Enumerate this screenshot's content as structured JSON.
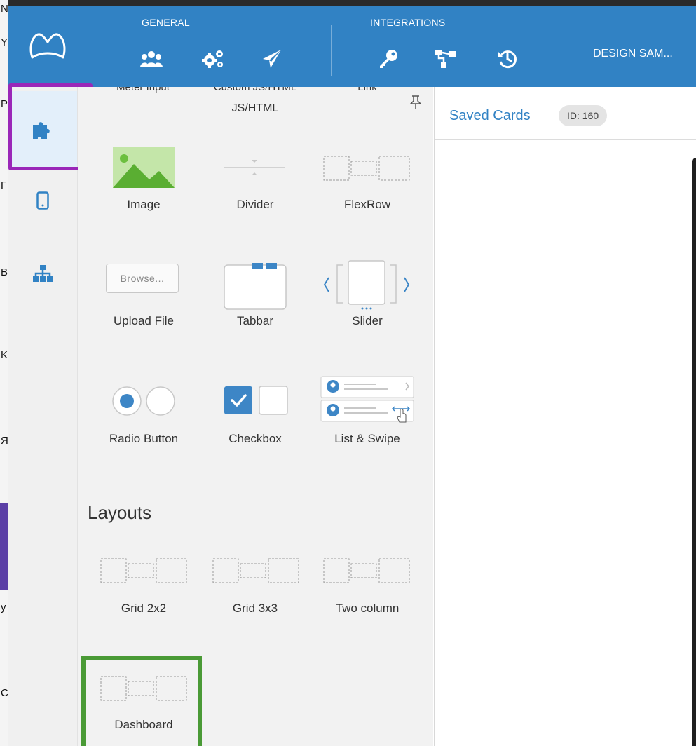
{
  "header": {
    "groups": [
      {
        "label": "GENERAL"
      },
      {
        "label": "INTEGRATIONS"
      }
    ],
    "app_name": "DESIGN SAM...",
    "icons": [
      "users-icon",
      "gears-icon",
      "send-icon",
      "key-icon",
      "hierarchy-icon",
      "history-icon"
    ],
    "color": "#3182c4"
  },
  "rail": {
    "items": [
      "puzzle-icon",
      "mobile-icon",
      "sitemap-icon"
    ],
    "active_index": 0
  },
  "components": {
    "partial_row": [
      "Meter Input",
      "Custom JS/HTML",
      "Link"
    ],
    "custom_label": "JS/HTML",
    "tiles": [
      {
        "label": "Image",
        "icon": "image-icon"
      },
      {
        "label": "Divider",
        "icon": "divider-icon"
      },
      {
        "label": "FlexRow",
        "icon": "flexrow-icon"
      },
      {
        "label": "Upload File",
        "icon": "upload-file-icon",
        "button_text": "Browse..."
      },
      {
        "label": "Tabbar",
        "icon": "tabbar-icon"
      },
      {
        "label": "Slider",
        "icon": "slider-icon"
      },
      {
        "label": "Radio Button",
        "icon": "radio-button-icon"
      },
      {
        "label": "Checkbox",
        "icon": "checkbox-icon"
      },
      {
        "label": "List & Swipe",
        "icon": "list-swipe-icon"
      }
    ]
  },
  "layouts": {
    "title": "Layouts",
    "tiles": [
      {
        "label": "Grid 2x2",
        "icon": "grid-2x2-icon"
      },
      {
        "label": "Grid 3x3",
        "icon": "grid-3x3-icon"
      },
      {
        "label": "Two column",
        "icon": "two-column-icon"
      },
      {
        "label": "Dashboard",
        "icon": "dashboard-icon"
      }
    ]
  },
  "main": {
    "page_title": "Saved Cards",
    "id_badge": "ID: 160"
  },
  "annotations": {
    "purple": "#9a27b8",
    "green": "#4a9a36"
  }
}
